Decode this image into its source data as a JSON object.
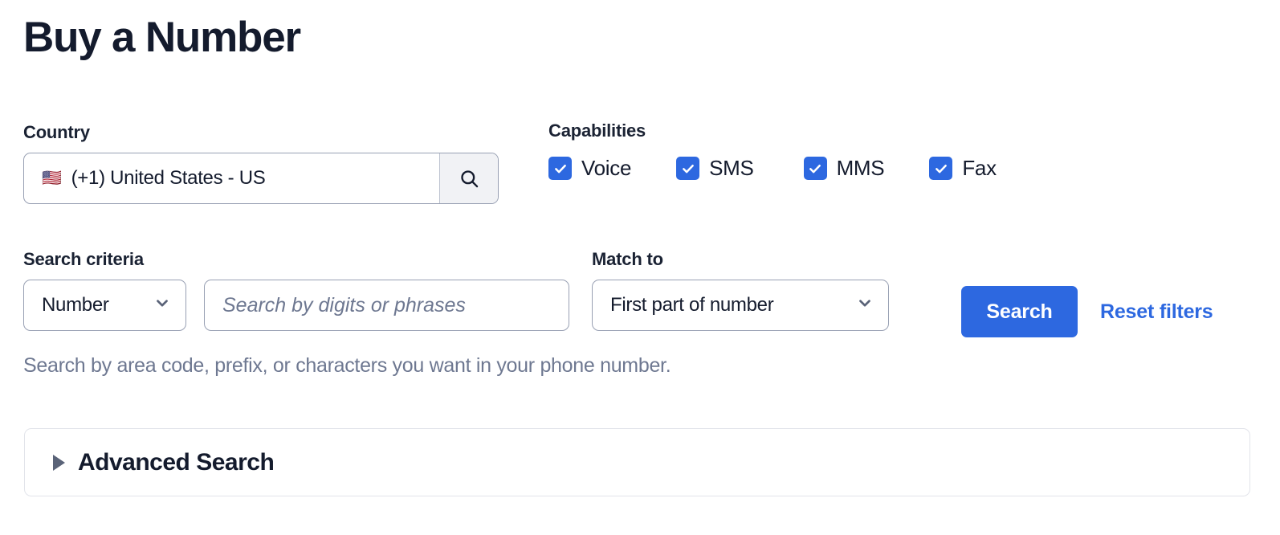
{
  "page": {
    "title": "Buy a Number"
  },
  "country": {
    "label": "Country",
    "flag": "🇺🇸",
    "value": "(+1) United States - US",
    "search_icon": "search-icon"
  },
  "capabilities": {
    "label": "Capabilities",
    "items": [
      {
        "label": "Voice",
        "checked": true
      },
      {
        "label": "SMS",
        "checked": true
      },
      {
        "label": "MMS",
        "checked": true
      },
      {
        "label": "Fax",
        "checked": true
      }
    ]
  },
  "search_criteria": {
    "label": "Search criteria",
    "criteria_select": {
      "value": "Number",
      "options": [
        "Number"
      ]
    },
    "query_input": {
      "value": "",
      "placeholder": "Search by digits or phrases"
    }
  },
  "match_to": {
    "label": "Match to",
    "select": {
      "value": "First part of number",
      "options": [
        "First part of number"
      ]
    }
  },
  "actions": {
    "search_label": "Search",
    "reset_label": "Reset filters"
  },
  "helper": {
    "text": "Search by area code, prefix, or characters you want in your phone number."
  },
  "advanced_search": {
    "title": "Advanced Search",
    "expanded": false
  },
  "colors": {
    "accent_blue": "#2d68e0",
    "text_dark": "#141b2d",
    "text_muted": "#6e7891",
    "border": "#98a0b3",
    "panel_border": "#e2e4ea",
    "icon_button_bg": "#f1f2f5"
  }
}
